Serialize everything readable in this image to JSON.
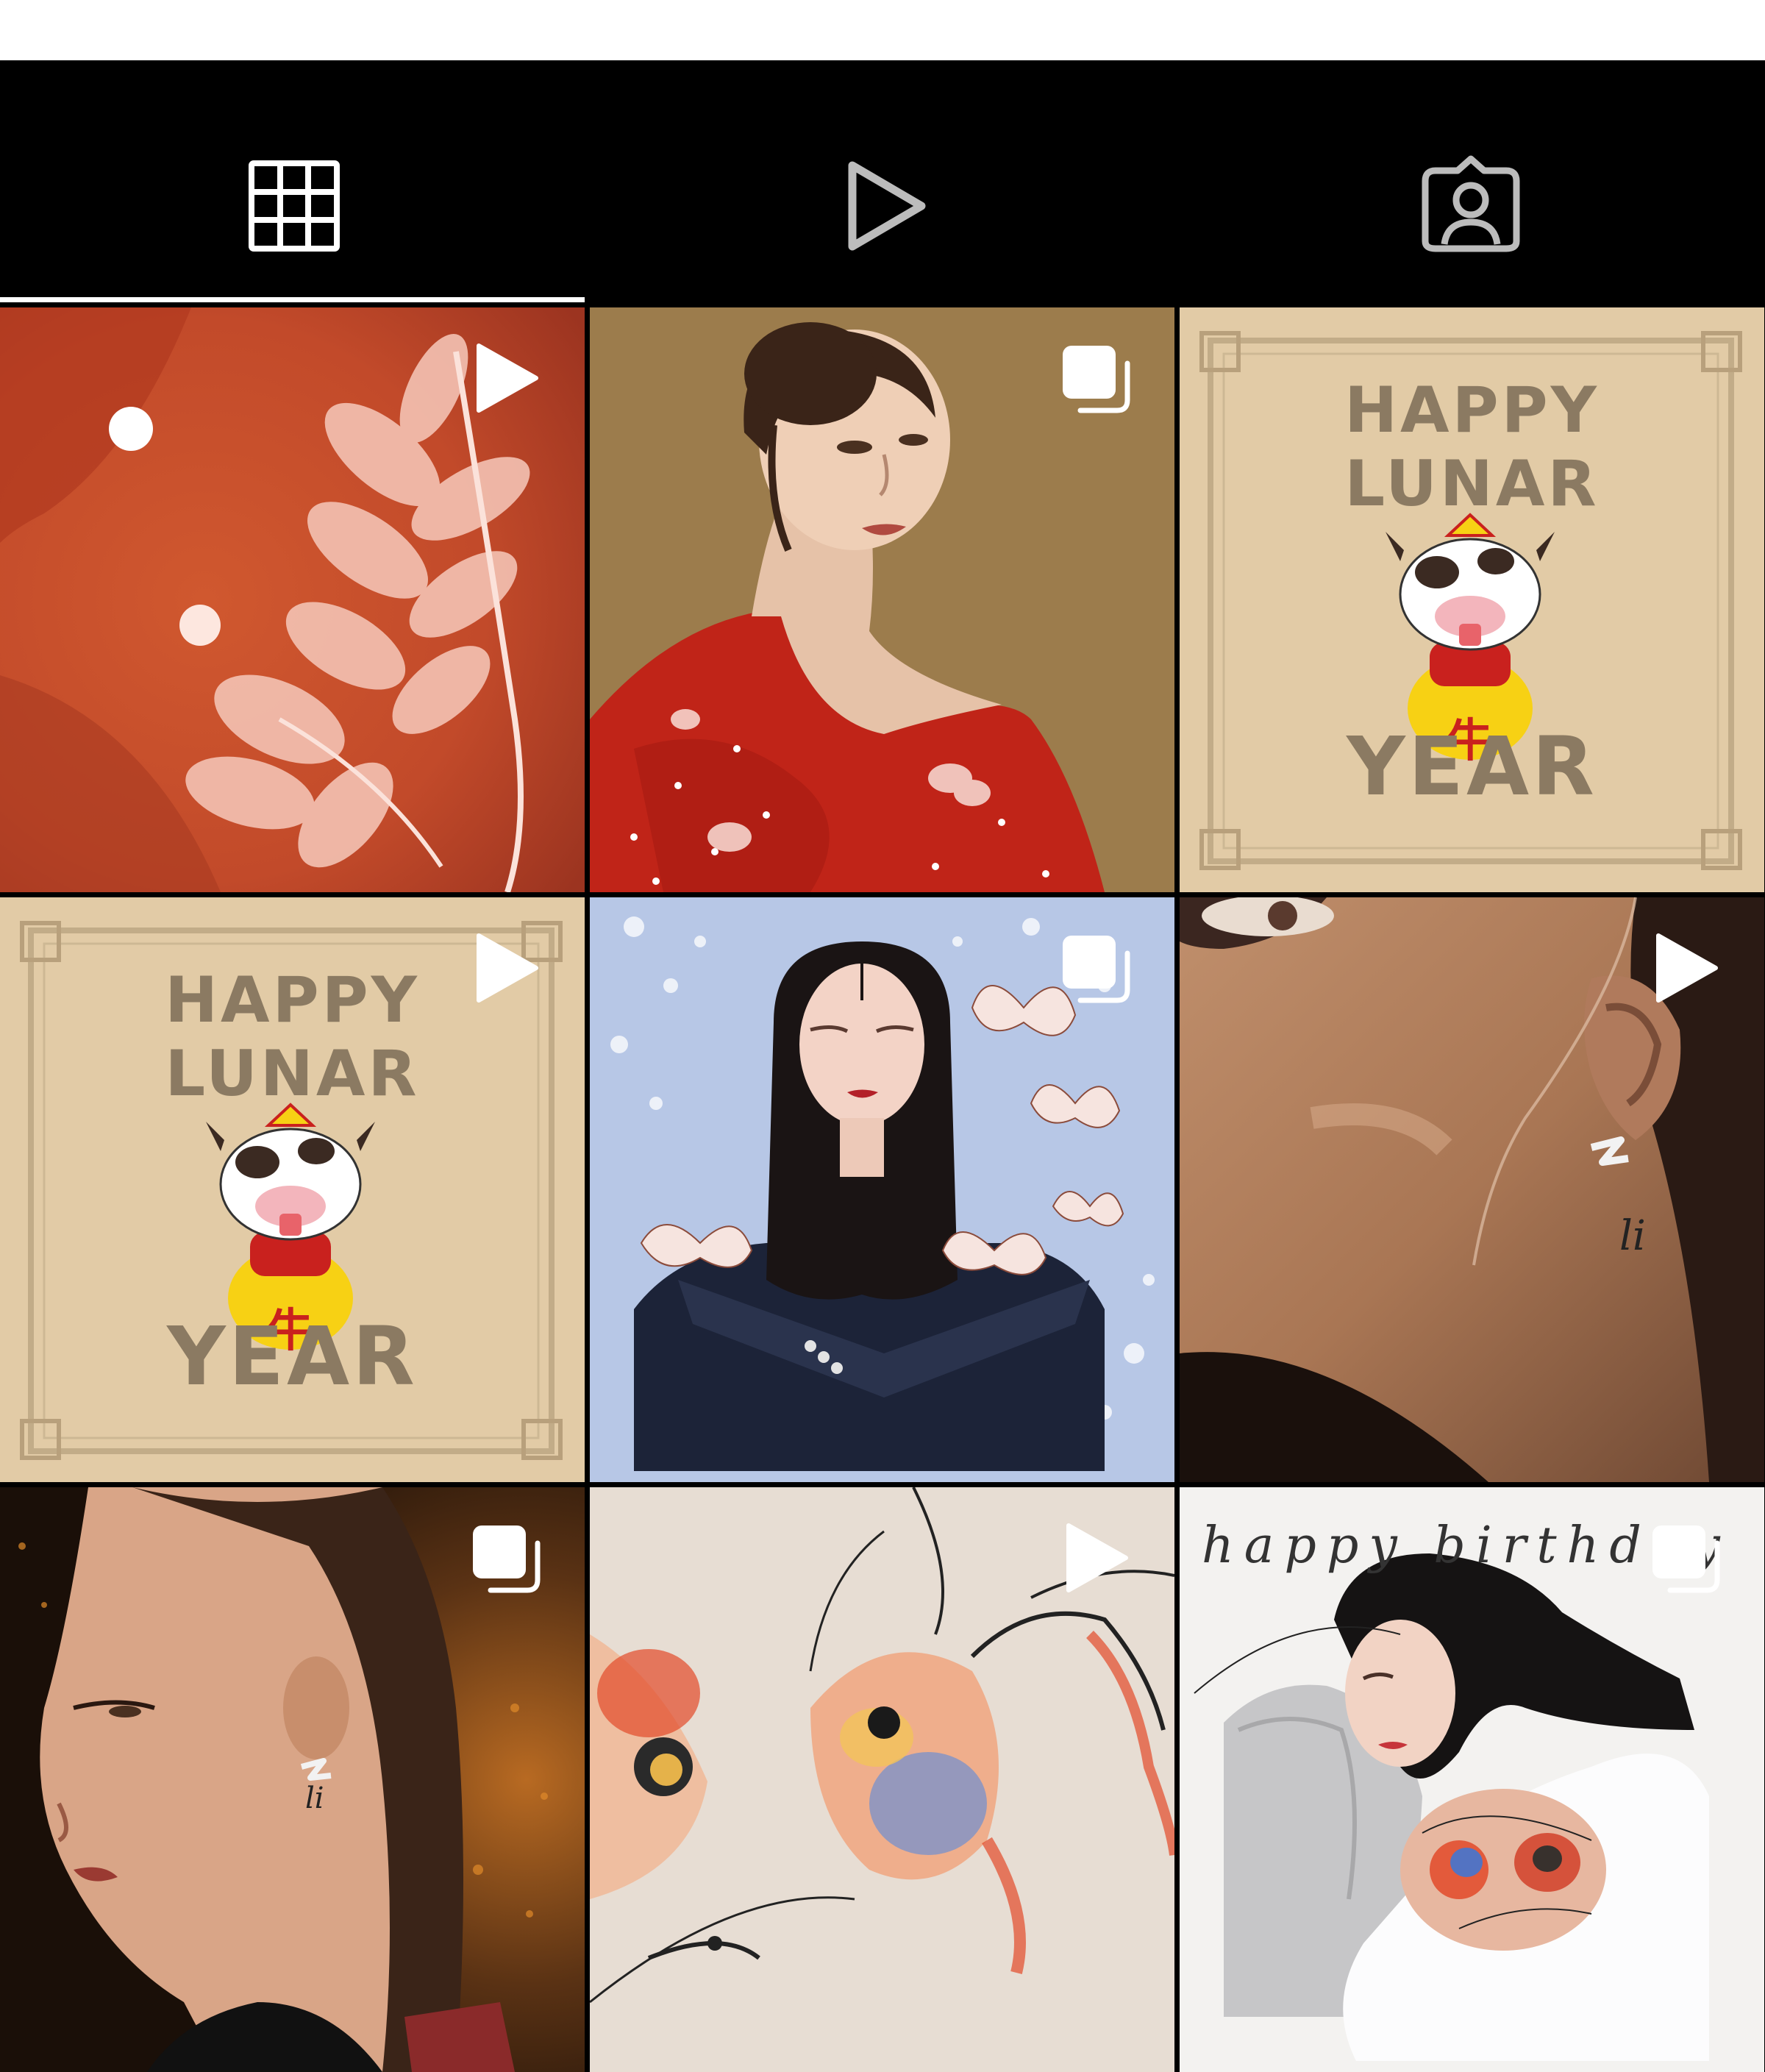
{
  "header": {
    "background": "#ffffff"
  },
  "tabs": [
    {
      "icon": "grid-icon",
      "selected": true
    },
    {
      "icon": "reels-play-icon",
      "selected": false
    },
    {
      "icon": "tagged-person-icon",
      "selected": false
    }
  ],
  "posts": [
    {
      "type": "video",
      "badge_icon": "reel-play-icon",
      "subject": "coral leaf on red background"
    },
    {
      "type": "carousel",
      "badge_icon": "carousel-stack-icon",
      "subject": "woman in red dress portrait"
    },
    {
      "type": "image",
      "badge_icon": "",
      "subject": "lunar new year ox card",
      "text": {
        "line1": "HAPPY",
        "line2": "LUNAR",
        "line3": "YEAR",
        "char": "牛"
      }
    },
    {
      "type": "video",
      "badge_icon": "reel-play-icon",
      "subject": "lunar new year ox card",
      "text": {
        "line1": "HAPPY",
        "line2": "LUNAR",
        "line3": "YEAR",
        "char": "牛"
      }
    },
    {
      "type": "carousel",
      "badge_icon": "carousel-stack-icon",
      "subject": "woman with butterflies"
    },
    {
      "type": "video",
      "badge_icon": "reel-play-icon",
      "subject": "close-up ear and jaw",
      "signature": "li"
    },
    {
      "type": "carousel",
      "badge_icon": "carousel-stack-icon",
      "subject": "woman profile with earring",
      "signature": "li"
    },
    {
      "type": "video",
      "badge_icon": "reel-play-icon",
      "subject": "koi fish watercolor"
    },
    {
      "type": "carousel",
      "badge_icon": "carousel-stack-icon",
      "subject": "happy birthday illustration",
      "text": {
        "caption": "happy birthday"
      }
    }
  ]
}
